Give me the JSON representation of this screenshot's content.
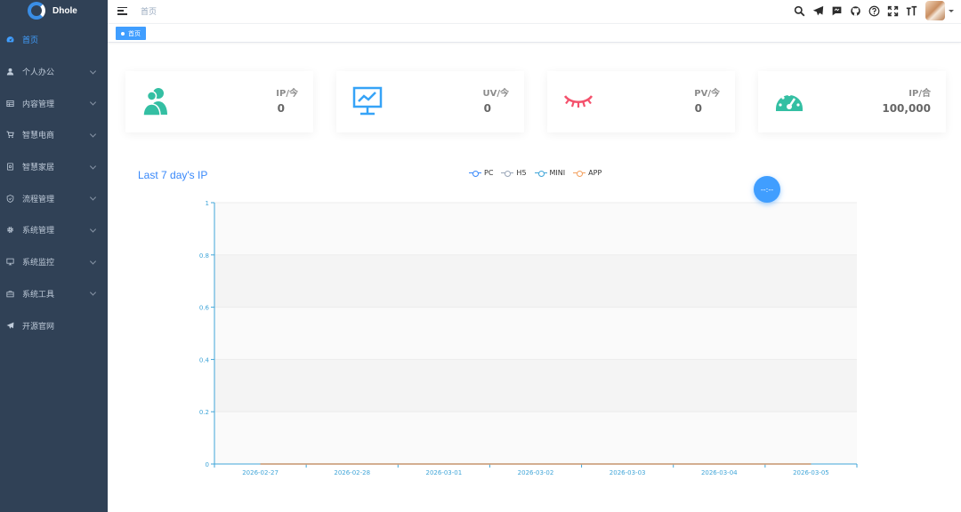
{
  "app": {
    "name": "Dhole"
  },
  "sidebar": {
    "items": [
      {
        "label": "首页",
        "icon": "dashboard-icon",
        "active": true,
        "has_children": false
      },
      {
        "label": "个人办公",
        "icon": "user-icon",
        "active": false,
        "has_children": true
      },
      {
        "label": "内容管理",
        "icon": "table-icon",
        "active": false,
        "has_children": true
      },
      {
        "label": "智慧电商",
        "icon": "cart-icon",
        "active": false,
        "has_children": true
      },
      {
        "label": "智慧家居",
        "icon": "home-device-icon",
        "active": false,
        "has_children": true
      },
      {
        "label": "流程管理",
        "icon": "shield-icon",
        "active": false,
        "has_children": true
      },
      {
        "label": "系统管理",
        "icon": "gear-icon",
        "active": false,
        "has_children": true
      },
      {
        "label": "系统监控",
        "icon": "monitor-icon",
        "active": false,
        "has_children": true
      },
      {
        "label": "系统工具",
        "icon": "toolbox-icon",
        "active": false,
        "has_children": true
      },
      {
        "label": "开源官网",
        "icon": "paper-plane-icon",
        "active": false,
        "has_children": false
      }
    ]
  },
  "header": {
    "breadcrumb": "首页",
    "icons": [
      "search-icon",
      "send-icon",
      "chat-icon",
      "github-icon",
      "help-icon",
      "fullscreen-icon",
      "font-size-icon"
    ]
  },
  "tags": [
    {
      "label": "首页",
      "active": true
    }
  ],
  "cards": [
    {
      "label": "IP/今",
      "value": "0",
      "icon": "people-icon",
      "color": "#34bfa3"
    },
    {
      "label": "UV/今",
      "value": "0",
      "icon": "chart-monitor-icon",
      "color": "#36a3f7"
    },
    {
      "label": "PV/今",
      "value": "0",
      "icon": "eye-closed-icon",
      "color": "#f4516c"
    },
    {
      "label": "IP/合",
      "value": "100,000",
      "icon": "gauge-icon",
      "color": "#34bfa3"
    }
  ],
  "floating_button": {
    "label": "--:--"
  },
  "chart_data": {
    "type": "line",
    "title": "Last 7 day's IP",
    "x": [
      "2026-02-27",
      "2026-02-28",
      "2026-03-01",
      "2026-03-02",
      "2026-03-03",
      "2026-03-04",
      "2026-03-05"
    ],
    "series": [
      {
        "name": "PC",
        "values": [
          0,
          0,
          0,
          0,
          0,
          0,
          0
        ],
        "color": "#3888fa"
      },
      {
        "name": "H5",
        "values": [
          0,
          0,
          0,
          0,
          0,
          0,
          0
        ],
        "color": "#9aa6b8"
      },
      {
        "name": "MINI",
        "values": [
          0,
          0,
          0,
          0,
          0,
          0,
          0
        ],
        "color": "#40a5d8"
      },
      {
        "name": "APP",
        "values": [
          0,
          0,
          0,
          0,
          0,
          0,
          0
        ],
        "color": "#f3a05e"
      }
    ],
    "ylim": [
      0,
      1
    ],
    "yticks": [
      0,
      0.2,
      0.4,
      0.6,
      0.8,
      1
    ],
    "ytick_labels": [
      "0",
      "0.2",
      "0.4",
      "0.6",
      "0.8",
      "1"
    ],
    "legend": "top-center",
    "grid": true
  }
}
